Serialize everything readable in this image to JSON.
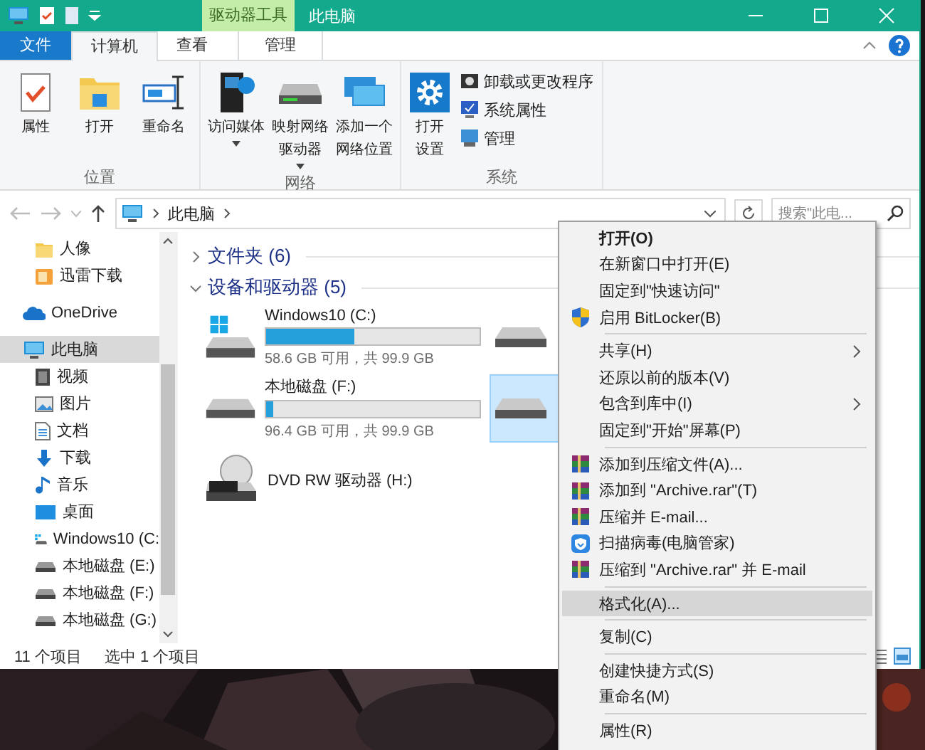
{
  "window": {
    "title": "此电脑",
    "context_group": "驱动器工具"
  },
  "ribbon_tabs": [
    {
      "label": "文件",
      "kind": "file",
      "selected": false
    },
    {
      "label": "计算机",
      "kind": "tab",
      "selected": true
    },
    {
      "label": "查看",
      "kind": "tab",
      "selected": false
    },
    {
      "label": "管理",
      "kind": "context",
      "selected": false
    }
  ],
  "ribbon_groups": [
    {
      "title": "位置",
      "buttons": [
        {
          "label": "属性",
          "kind": "large",
          "dropdown": false
        },
        {
          "label": "打开",
          "kind": "large",
          "dropdown": false
        },
        {
          "label": "重命名",
          "kind": "large",
          "dropdown": false
        }
      ]
    },
    {
      "title": "网络",
      "buttons": [
        {
          "label": "访问媒体",
          "kind": "large",
          "dropdown": true
        },
        {
          "label": "映射网络驱动器",
          "kind": "large",
          "dropdown": true
        },
        {
          "label": "添加一个网络位置",
          "kind": "large",
          "dropdown": false
        }
      ]
    },
    {
      "title": "系统",
      "buttons": [
        {
          "label": "打开设置",
          "kind": "narrow",
          "dropdown": false
        },
        {
          "label": "卸载或更改程序",
          "kind": "small",
          "dropdown": false
        },
        {
          "label": "系统属性",
          "kind": "small",
          "dropdown": false
        },
        {
          "label": "管理",
          "kind": "small",
          "dropdown": false
        }
      ]
    }
  ],
  "address": {
    "path": [
      "此电脑"
    ]
  },
  "search": {
    "placeholder": "搜索\"此电..."
  },
  "nav_tree": [
    {
      "children": [
        {
          "label": "人像",
          "selected": false
        },
        {
          "label": "迅雷下载",
          "selected": false
        }
      ]
    },
    {
      "label": "OneDrive",
      "selected": false
    },
    {
      "label": "此电脑",
      "selected": true,
      "children": [
        {
          "label": "视频",
          "selected": false
        },
        {
          "label": "图片",
          "selected": false
        },
        {
          "label": "文档",
          "selected": false
        },
        {
          "label": "下载",
          "selected": false
        },
        {
          "label": "音乐",
          "selected": false
        },
        {
          "label": "桌面",
          "selected": false
        },
        {
          "label": "Windows10 (C:",
          "selected": false
        },
        {
          "label": "本地磁盘 (E:)",
          "selected": false
        },
        {
          "label": "本地磁盘 (F:)",
          "selected": false
        },
        {
          "label": "本地磁盘 (G:)",
          "selected": false
        }
      ]
    }
  ],
  "sections": [
    {
      "title": "文件夹 (6)",
      "expanded": false
    },
    {
      "title": "设备和驱动器 (5)",
      "expanded": true,
      "drives": [
        {
          "kind": "system",
          "name": "Windows10 (C:)",
          "level": 0.41,
          "free": "58.6 GB 可用，共 99.9 GB",
          "selected": false
        },
        {
          "kind": "disk",
          "selected": false
        },
        {
          "kind": "disk",
          "name": "本地磁盘 (F:)",
          "level": 0.035,
          "free": "96.4 GB 可用，共 99.9 GB",
          "selected": false
        },
        {
          "kind": "disk",
          "selected": true
        },
        {
          "kind": "dvd",
          "name": "DVD RW 驱动器 (H:)",
          "selected": false
        }
      ]
    }
  ],
  "status_bar": {
    "items": "11 个项目",
    "selection": "选中 1 个项目"
  },
  "context_menu": [
    {
      "kind": "item",
      "label": "打开(O)",
      "default": true,
      "submenu": false,
      "highlighted": false
    },
    {
      "kind": "item",
      "label": "在新窗口中打开(E)",
      "default": false,
      "submenu": false,
      "highlighted": false
    },
    {
      "kind": "item",
      "label": "固定到\"快速访问\"",
      "default": false,
      "submenu": false,
      "highlighted": false
    },
    {
      "kind": "item",
      "label": "启用 BitLocker(B)",
      "default": false,
      "submenu": false,
      "highlighted": false
    },
    {
      "kind": "separator"
    },
    {
      "kind": "item",
      "label": "共享(H)",
      "default": false,
      "submenu": true,
      "highlighted": false
    },
    {
      "kind": "item",
      "label": "还原以前的版本(V)",
      "default": false,
      "submenu": false,
      "highlighted": false
    },
    {
      "kind": "item",
      "label": "包含到库中(I)",
      "default": false,
      "submenu": true,
      "highlighted": false
    },
    {
      "kind": "item",
      "label": "固定到\"开始\"屏幕(P)",
      "default": false,
      "submenu": false,
      "highlighted": false
    },
    {
      "kind": "separator"
    },
    {
      "kind": "item",
      "label": "添加到压缩文件(A)...",
      "default": false,
      "submenu": false,
      "highlighted": false
    },
    {
      "kind": "item",
      "label": "添加到 \"Archive.rar\"(T)",
      "default": false,
      "submenu": false,
      "highlighted": false
    },
    {
      "kind": "item",
      "label": "压缩并 E-mail...",
      "default": false,
      "submenu": false,
      "highlighted": false
    },
    {
      "kind": "item",
      "label": "扫描病毒(电脑管家)",
      "default": false,
      "submenu": false,
      "highlighted": false
    },
    {
      "kind": "item",
      "label": "压缩到 \"Archive.rar\" 并 E-mail",
      "default": false,
      "submenu": false,
      "highlighted": false
    },
    {
      "kind": "separator"
    },
    {
      "kind": "item",
      "label": "格式化(A)...",
      "default": false,
      "submenu": false,
      "highlighted": true
    },
    {
      "kind": "separator"
    },
    {
      "kind": "item",
      "label": "复制(C)",
      "default": false,
      "submenu": false,
      "highlighted": false
    },
    {
      "kind": "separator"
    },
    {
      "kind": "item",
      "label": "创建快捷方式(S)",
      "default": false,
      "submenu": false,
      "highlighted": false
    },
    {
      "kind": "item",
      "label": "重命名(M)",
      "default": false,
      "submenu": false,
      "highlighted": false
    },
    {
      "kind": "separator"
    },
    {
      "kind": "item",
      "label": "属性(R)",
      "default": false,
      "submenu": false,
      "highlighted": false
    }
  ]
}
